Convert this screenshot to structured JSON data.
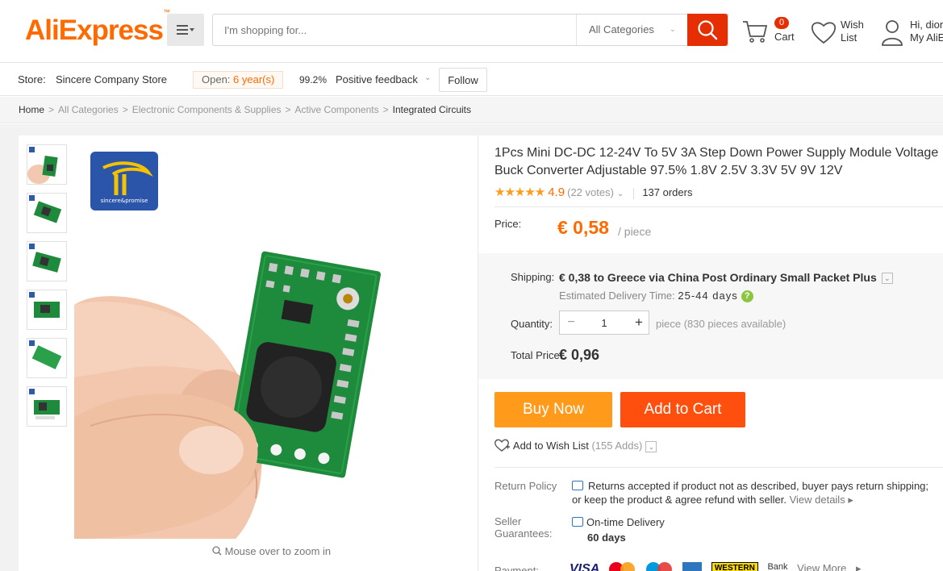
{
  "header": {
    "logo": "AliExpress",
    "logo_tm": "™",
    "search_placeholder": "I'm shopping for...",
    "category_select": "All Categories",
    "cart_count": "0",
    "cart_label": "Cart",
    "wish_label_1": "Wish",
    "wish_label_2": "List",
    "account_line1": "Hi, dior",
    "account_line2": "My AliE"
  },
  "store": {
    "label": "Store:",
    "name": "Sincere Company Store",
    "open_prefix": "Open:",
    "open_years": "6 year(s)",
    "feedback_pct": "99.2%",
    "feedback_label": "Positive feedback",
    "follow_label": "Follow"
  },
  "breadcrumb": [
    "Home",
    "All Categories",
    "Electronic Components & Supplies",
    "Active Components",
    "Integrated Circuits"
  ],
  "breadcrumb_sep": ">",
  "gallery": {
    "zoom_hint": "Mouse over to zoom in",
    "brand_line": "sincere&promise"
  },
  "product": {
    "title": "1Pcs Mini DC-DC 12-24V To 5V 3A Step Down Power Supply Module Voltage Buck Converter Adjustable 97.5% 1.8V 2.5V 3.3V 5V 9V 12V",
    "rating": 4.9,
    "rating_text": "4.9",
    "votes": "(22 votes)",
    "orders": "137 orders",
    "price_label": "Price:",
    "price": "€ 0,58",
    "price_unit": "/ piece",
    "shipping_label": "Shipping:",
    "shipping_price": "€ 0,38",
    "shipping_to": " to Greece via China Post Ordinary Small Packet Plus",
    "est_label": "Estimated Delivery Time:",
    "est_days": "25-44 days",
    "quantity_label": "Quantity:",
    "quantity_value": "1",
    "quantity_avail": "piece (830 pieces available)",
    "total_label": "Total Price:",
    "total_value": "€ 0,96",
    "buy_now": "Buy Now",
    "add_to_cart": "Add to Cart",
    "wish_add": "Add to Wish List",
    "wish_adds": "(155 Adds)",
    "return_label": "Return Policy",
    "return_text": "Returns accepted if product not as described, buyer pays return shipping; or keep the product & agree refund with seller.",
    "return_link": "View details",
    "seller_guarantee_label_1": "Seller",
    "seller_guarantee_label_2": "Guarantees:",
    "ontime_label": "On-time Delivery",
    "ontime_days": "60 days",
    "payment_label": "Payment:",
    "pay_visa": "VISA",
    "pay_wu": "WESTERN",
    "pay_bank": "Bank",
    "view_more": "View More"
  },
  "colors": {
    "brand": "#ff6a00",
    "search_btn": "#e62e04",
    "buy_now": "#ff9a1a",
    "add_cart": "#ff4f0f",
    "star": "#ff9a1a",
    "pcb_green": "#1e8a3c"
  }
}
